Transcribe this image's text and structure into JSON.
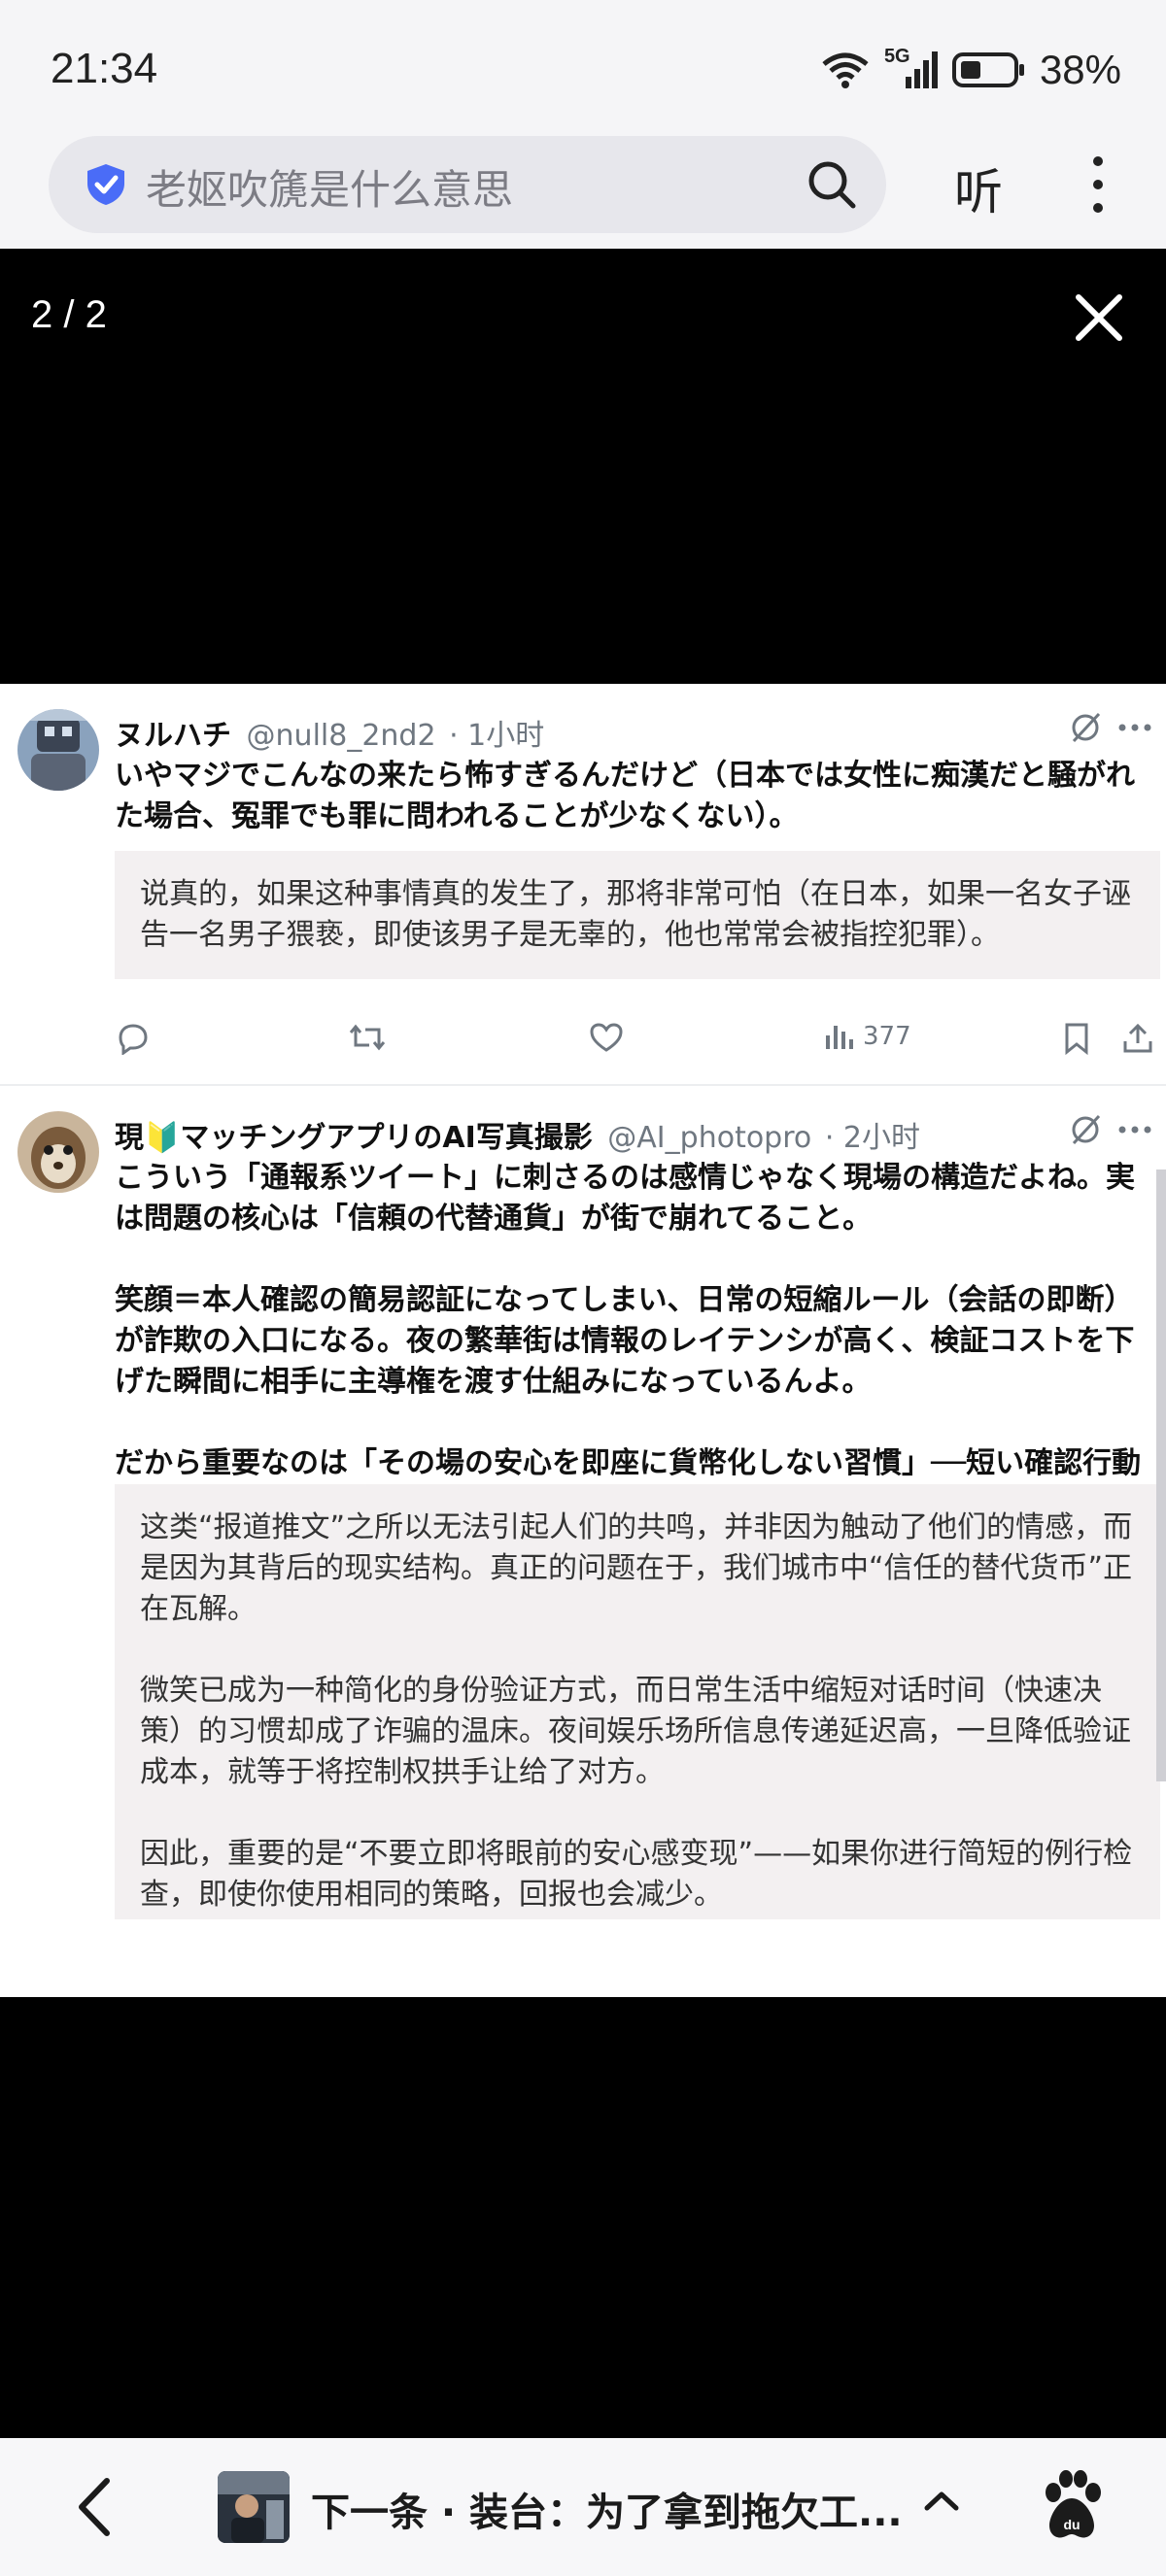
{
  "status": {
    "time": "21:34",
    "network": "5G",
    "battery_pct": "38%"
  },
  "search": {
    "query": "老妪吹篪是什么意思",
    "listen_label": "听"
  },
  "viewer": {
    "counter": "2 / 2"
  },
  "tweets": [
    {
      "name": "ヌルハチ",
      "handle": "@null8_2nd2",
      "time": "· 1小时",
      "body": [
        "いやマジでこんなの来たら怖すぎるんだけど（日本では女性に痴漢だと騒がれた場合、冤罪でも罪に問われることが少なくない）。"
      ],
      "translation": [
        "说真的，如果这种事情真的发生了，那将非常可怕（在日本，如果一名女子诬告一名男子猥亵，即使该男子是无辜的，他也常常会被指控犯罪）。"
      ],
      "views": "377"
    },
    {
      "name": "現🔰マッチングアプリのAI写真撮影",
      "handle": "@AI_photopro",
      "time": "· 2小时",
      "body": [
        "こういう「通報系ツイート」に刺さるのは感情じゃなく現場の構造だよね。実は問題の核心は「信頼の代替通貨」が街で崩れてること。",
        "笑顔＝本人確認の簡易認証になってしまい、日常の短縮ルール（会話の即断）が詐欺の入口になる。夜の繁華街は情報のレイテンシが高く、検証コストを下げた瞬間に相手に主導権を渡す仕組みになっているんよ。",
        "だから重要なのは「その場の安心を即座に貨幣化しない習慣」──短い確認行動をルーチン化すれば、同じ手口でもリターンが下がる。"
      ],
      "translation": [
        "这类“报道推文”之所以无法引起人们的共鸣，并非因为触动了他们的情感，而是因为其背后的现实结构。真正的问题在于，我们城市中“信任的替代货币”正在瓦解。",
        "微笑已成为一种简化的身份验证方式，而日常生活中缩短对话时间（快速决策）的习惯却成了诈骗的温床。夜间娱乐场所信息传递延迟高，一旦降低验证成本，就等于将控制权拱手让给了对方。",
        "因此，重要的是“不要立即将眼前的安心感变现”——如果你进行简短的例行检查，即使你使用相同的策略，回报也会减少。"
      ]
    }
  ],
  "bottom": {
    "next_text": "下一条 · 装台：为了拿到拖欠工..."
  },
  "colors": {
    "accent_blue": "#4a6cf7",
    "viewer_bg": "#000000",
    "translation_bg": "#f3f0f1"
  }
}
